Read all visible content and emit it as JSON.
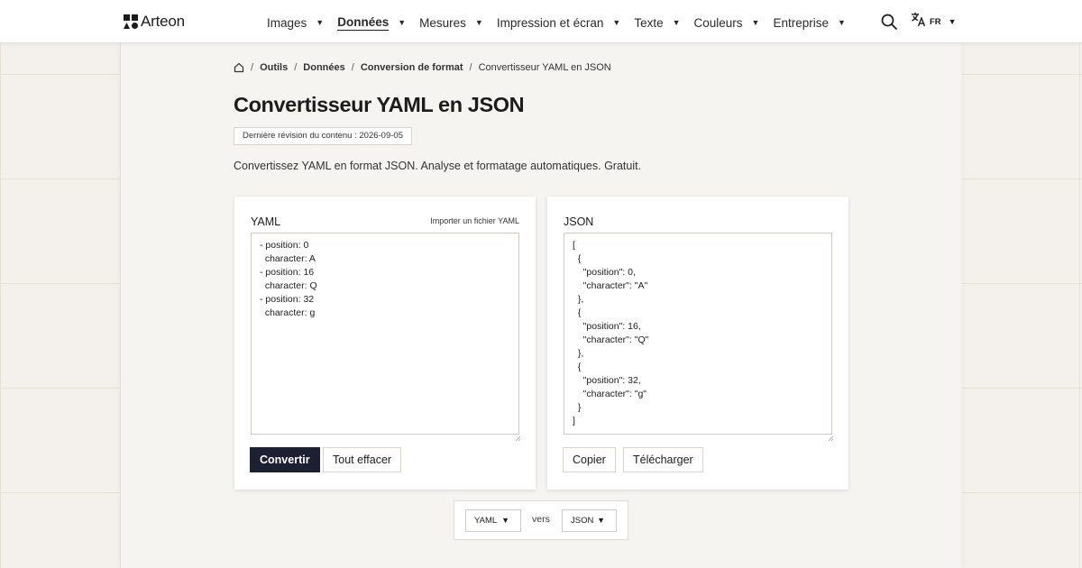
{
  "brand": {
    "name": "Arteon"
  },
  "nav": {
    "items": [
      {
        "label": "Images",
        "active": false
      },
      {
        "label": "Données",
        "active": true
      },
      {
        "label": "Mesures",
        "active": false
      },
      {
        "label": "Impression et écran",
        "active": false
      },
      {
        "label": "Texte",
        "active": false
      },
      {
        "label": "Couleurs",
        "active": false
      },
      {
        "label": "Entreprise",
        "active": false
      }
    ],
    "caret": "▼",
    "search_icon": "search-icon",
    "language": {
      "icon": "translate-icon",
      "code": "FR"
    }
  },
  "breadcrumb": {
    "home_icon": "home-icon",
    "separator": "/",
    "items": [
      "Outils",
      "Données",
      "Conversion de format"
    ],
    "current": "Convertisseur YAML en JSON"
  },
  "page": {
    "title": "Convertisseur YAML en JSON",
    "revision": "Dernière révision du contenu : 2026-09-05",
    "intro": "Convertissez YAML en format JSON. Analyse et formatage automatiques. Gratuit."
  },
  "input_panel": {
    "title": "YAML",
    "import_label": "Importer un fichier YAML",
    "value": "- position: 0\n  character: A\n- position: 16\n  character: Q\n- position: 32\n  character: g",
    "convert_label": "Convertir",
    "clear_label": "Tout effacer"
  },
  "output_panel": {
    "title": "JSON",
    "value": "[\n  {\n    \"position\": 0,\n    \"character\": \"A\"\n  },\n  {\n    \"position\": 16,\n    \"character\": \"Q\"\n  },\n  {\n    \"position\": 32,\n    \"character\": \"g\"\n  }\n]",
    "copy_label": "Copier",
    "download_label": "Télécharger"
  },
  "format_bar": {
    "from": "YAML",
    "connector": "vers",
    "to": "JSON"
  },
  "colors": {
    "background": "#f4f1ec",
    "panel": "#f6f4f1",
    "primary_button": "#1d1f33",
    "text": "#1c1c1c"
  }
}
